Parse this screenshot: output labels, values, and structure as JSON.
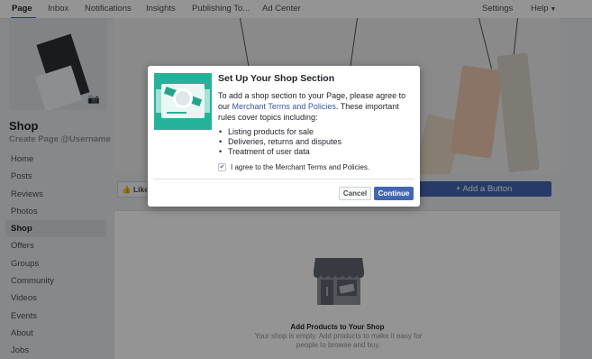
{
  "topnav": {
    "items": [
      "Page",
      "Inbox",
      "Notifications",
      "Insights",
      "Publishing To...",
      "Ad Center"
    ],
    "right_items": [
      "Settings",
      "Help"
    ],
    "active": "Page"
  },
  "page": {
    "name": "Shop",
    "username_link": "Create Page @Username"
  },
  "sidebar": {
    "items": [
      {
        "label": "Home"
      },
      {
        "label": "Posts"
      },
      {
        "label": "Reviews"
      },
      {
        "label": "Photos"
      },
      {
        "label": "Shop",
        "active": true
      },
      {
        "label": "Offers"
      },
      {
        "label": "Groups"
      },
      {
        "label": "Community"
      },
      {
        "label": "Videos"
      },
      {
        "label": "Events"
      },
      {
        "label": "About"
      },
      {
        "label": "Jobs"
      }
    ]
  },
  "actions": {
    "like_label": "Like",
    "add_button_label": "+ Add a Button"
  },
  "shop_empty": {
    "title": "Add Products to Your Shop",
    "description": "Your shop is empty. Add products to make it easy for people to browse and buy."
  },
  "modal": {
    "title": "Set Up Your Shop Section",
    "text_before_link": "To add a shop section to your Page, please agree to our ",
    "link_text": "Merchant Terms and Policies",
    "text_after_link": ". These important rules cover topics including:",
    "list": [
      "Listing products for sale",
      "Deliveries, returns and disputes",
      "Treatment of user data"
    ],
    "checkbox_label": "I agree to the Merchant Terms and Policies.",
    "checkbox_checked": true,
    "cancel_label": "Cancel",
    "continue_label": "Continue"
  },
  "icons": {
    "camera": "camera-icon",
    "like": "thumbs-up-icon",
    "store": "storefront-icon",
    "check": "checkmark-icon",
    "illustration": "watch-product-illustration"
  },
  "colors": {
    "brand_blue": "#4267b2",
    "link_blue": "#365899",
    "illustration_teal": "#24b39a",
    "overlay": "rgba(0,0,0,0.42)"
  }
}
